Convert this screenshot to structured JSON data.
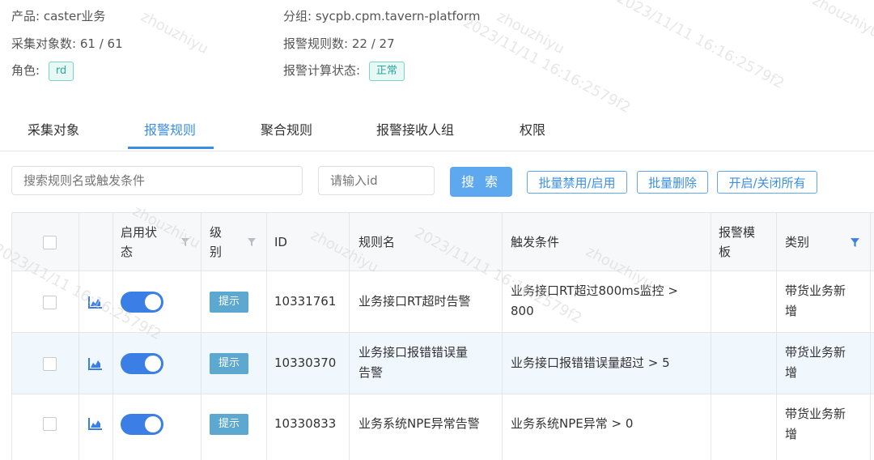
{
  "info": {
    "product_label": "产品:",
    "product_value": "caster业务",
    "group_label": "分组:",
    "group_value": "sycpb.cpm.tavern-platform",
    "collect_label": "采集对象数:",
    "collect_value": "61 / 61",
    "rules_label": "报警规则数:",
    "rules_value": "22 / 27",
    "role_label": "角色:",
    "role_value": "rd",
    "calc_label": "报警计算状态:",
    "calc_value": "正常"
  },
  "tabs": [
    "采集对象",
    "报警规则",
    "聚合规则",
    "报警接收人组",
    "权限"
  ],
  "active_tab": 1,
  "toolbar": {
    "search_placeholder": "搜索规则名或触发条件",
    "id_placeholder": "请输入id",
    "search_button": "搜 索",
    "batch_toggle": "批量禁用/启用",
    "batch_delete": "批量删除",
    "toggle_all": "开启/关闭所有"
  },
  "table": {
    "headers": {
      "status_l1": "启用状",
      "status_l2": "态",
      "level_l1": "级",
      "level_l2": "别",
      "id": "ID",
      "name": "规则名",
      "trigger": "触发条件",
      "template_l1": "报警模",
      "template_l2": "板",
      "category": "类别"
    },
    "rows": [
      {
        "level": "提示",
        "id": "10331761",
        "name_l1": "业务接口RT超时告警",
        "name_l2": "",
        "trigger_l1": "业务接口RT超过800ms监控 >",
        "trigger_l2": "800",
        "category_l1": "带货业务新",
        "category_l2": "增",
        "enabled": true
      },
      {
        "level": "提示",
        "id": "10330370",
        "name_l1": "业务接口报错错误量",
        "name_l2": "告警",
        "trigger_l1": "业务接口报错错误量超过 > 5",
        "trigger_l2": "",
        "category_l1": "带货业务新",
        "category_l2": "增",
        "enabled": true
      },
      {
        "level": "提示",
        "id": "10330833",
        "name_l1": "业务系统NPE异常告警",
        "name_l2": "",
        "trigger_l1": "业务系统NPE异常 > 0",
        "trigger_l2": "",
        "category_l1": "带货业务新",
        "category_l2": "增",
        "enabled": true
      }
    ]
  },
  "watermark": {
    "user": "zhouzhiyu",
    "stamp": "2023/11/11 16:16:2579f2"
  },
  "colors": {
    "primary": "#3a8ee6",
    "primary_button": "#5ea8f0",
    "toggle_on": "#3a7ee6",
    "level_tag": "#5da8d0",
    "status_tag": "#2aa79a",
    "highlight_row": "#f0f7fd"
  }
}
